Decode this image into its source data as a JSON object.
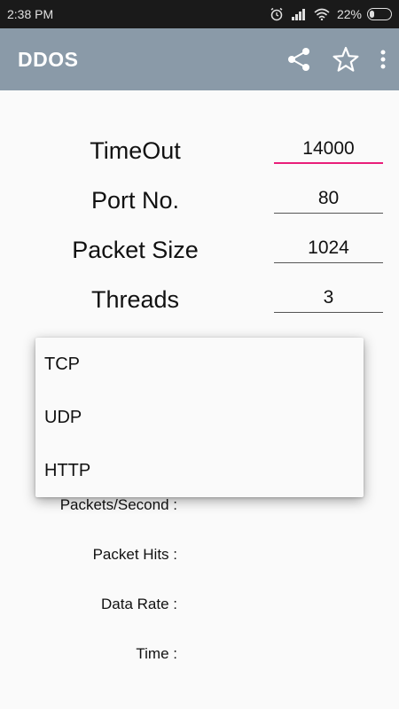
{
  "status_bar": {
    "time": "2:38 PM",
    "battery_percent": "22%",
    "battery_level": 0.22,
    "icons": [
      "alarm-icon",
      "signal-icon",
      "wifi-icon",
      "battery-icon"
    ]
  },
  "app_bar": {
    "title": "DDOS",
    "actions": [
      "share-icon",
      "star-icon",
      "more-vert-icon"
    ],
    "color": "#8a9aa8"
  },
  "form": {
    "timeout": {
      "label": "TimeOut",
      "value": "14000"
    },
    "port": {
      "label": "Port No.",
      "value": "80"
    },
    "packet_size": {
      "label": "Packet Size",
      "value": "1024"
    },
    "threads": {
      "label": "Threads",
      "value": "3"
    },
    "focus_color": "#e91e7a"
  },
  "dropdown": {
    "options": [
      "TCP",
      "UDP",
      "HTTP"
    ]
  },
  "stats": {
    "packets_per_second": "Packets/Second :",
    "packet_hits": "Packet Hits :",
    "data_rate": "Data Rate :",
    "time": "Time :"
  }
}
